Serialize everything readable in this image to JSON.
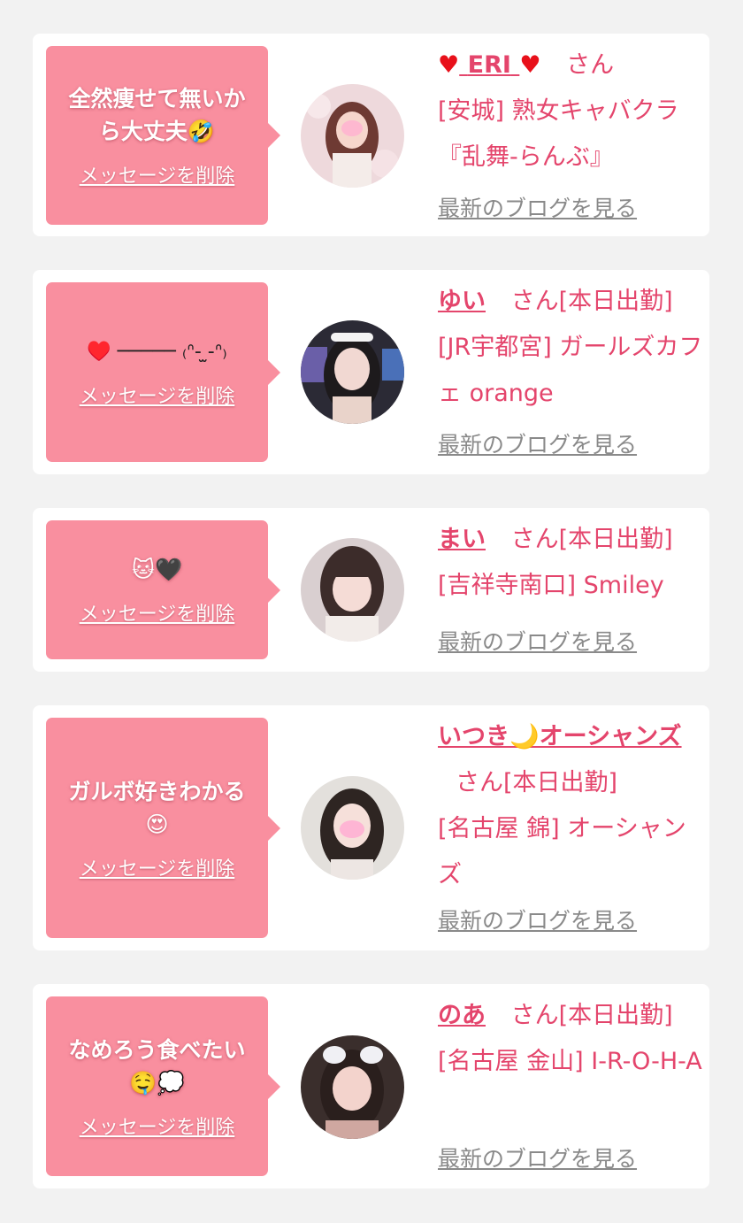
{
  "delete_label": "メッセージを削除",
  "blog_label": "最新のブログを見る",
  "san_label": "さん",
  "colors": {
    "background": "#f2f2f2",
    "bubble": "#f98f9f",
    "accent": "#e4456c",
    "heart": "#e8101a",
    "link_gray": "#8a8a8a"
  },
  "cards": [
    {
      "message": "全然痩せて無いから大丈夫🤣",
      "name": "ERI",
      "name_icons": [
        "heart-icon",
        "heart-icon"
      ],
      "status": "",
      "shop": "[安城] 熟女キャバクラ『乱舞-らんぶ』"
    },
    {
      "message": "♥️ ───── ₍ᐢ- ̫-ᐢ₎",
      "name": "ゆい",
      "status": "[本日出勤]",
      "shop": "[JR宇都宮] ガールズカフェ orange"
    },
    {
      "message": "🐱🖤",
      "name": "まい",
      "status": "[本日出勤]",
      "shop": "[吉祥寺南口] Smiley"
    },
    {
      "message": "ガルボ好きわかる😍",
      "name": "いつき🌙オーシャンズ",
      "status": "[本日出勤]",
      "shop": "[名古屋 錦] オーシャンズ"
    },
    {
      "message": "なめろう食べたい🤤💭",
      "name": "のあ",
      "status": "[本日出勤]",
      "shop": "[名古屋 金山] I-R-O-H-A"
    }
  ]
}
